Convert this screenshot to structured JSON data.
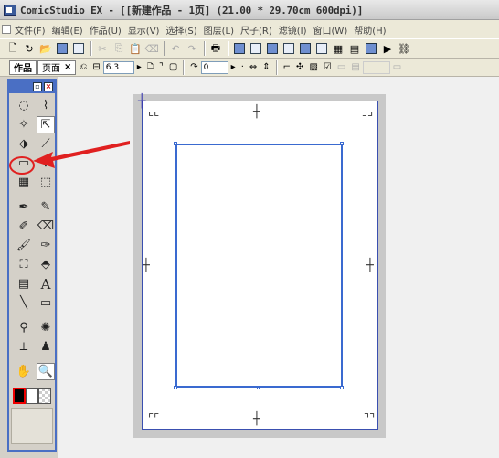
{
  "window": {
    "title": "ComicStudio EX - [[新建作品 - 1页] (21.00 * 29.70cm 600dpi)]"
  },
  "menu": [
    "文件(F)",
    "编辑(E)",
    "作品(U)",
    "显示(V)",
    "选择(S)",
    "图层(L)",
    "尺子(R)",
    "滤镜(I)",
    "窗口(W)",
    "帮助(H)"
  ],
  "tabs": {
    "work": "作品",
    "page": "页面",
    "close": "×"
  },
  "toolbar2": {
    "brush_size": "6.3",
    "angle": "0"
  },
  "icons": {
    "new": "new-file-icon",
    "open": "open-icon",
    "save": "save-icon",
    "print": "print-icon"
  },
  "tools": [
    "ellipse-select-icon",
    "lasso-icon",
    "magic-wand-icon",
    "object-select-icon",
    "layer-move-icon",
    "eyedropper-icon",
    "ruler-maker-icon",
    "ruler-move-icon",
    "panel-ruler-icon",
    "perspective-ruler-icon",
    "pen-icon",
    "pencil-icon",
    "marker-icon",
    "eraser-icon",
    "brush-icon",
    "airbrush-icon",
    "fill-icon",
    "pattern-brush-icon",
    "gradient-icon",
    "text-icon",
    "line-icon",
    "rectangle-icon",
    "balloon-icon",
    "effect-line-icon",
    "tone-scrape-icon",
    "stamp-icon",
    "hand-icon",
    "zoom-icon"
  ],
  "text_tool_glyph": "A",
  "accent_colors": {
    "panel_border": "#4a6fc4",
    "annotation": "#e02020",
    "frame": "#3a6ad0"
  }
}
